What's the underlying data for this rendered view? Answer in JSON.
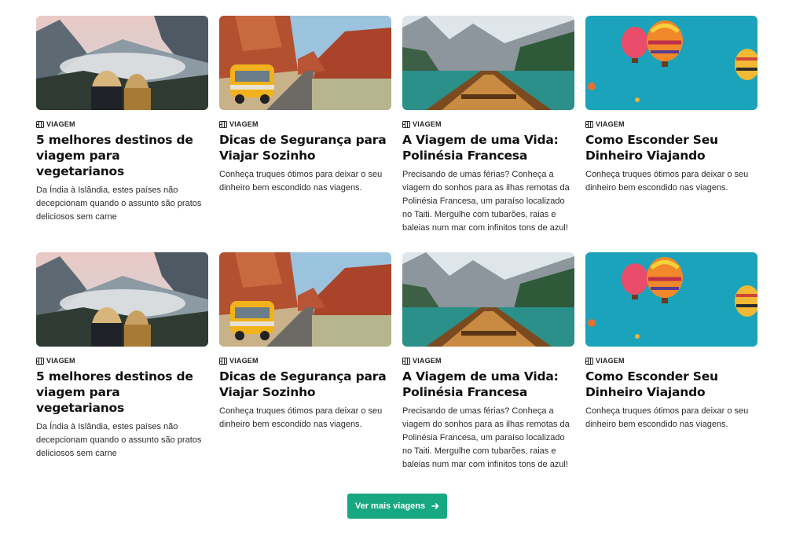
{
  "rows": [
    {
      "cards": [
        {
          "category": "VIAGEM",
          "image": "mountain-valley-two-women",
          "title": "5 melhores destinos de viagem para vegetarianos",
          "description": "Da Índia à Islândia, estes países não decepcionam quando o assunto são pratos deliciosos sem carne"
        },
        {
          "category": "VIAGEM",
          "image": "desert-road-yellow-van",
          "title": "Dicas de Segurança para Viajar Sozinho",
          "description": "Conheça truques ótimos para deixar o seu dinheiro bem escondido nas viagens."
        },
        {
          "category": "VIAGEM",
          "image": "lake-boat-mountains",
          "title": "A Viagem de uma Vida: Polinésia Francesa",
          "description": "Precisando de umas férias? Conheça a viagem do sonhos para as ilhas remotas da Polinésia Francesa, um paraíso localizado no Taiti. Mergulhe com tubarões, raias e baleias num mar com infinitos tons de azul!"
        },
        {
          "category": "VIAGEM",
          "image": "hot-air-balloons",
          "title": "Como Esconder Seu Dinheiro Viajando",
          "description": "Conheça truques ótimos para deixar o seu dinheiro bem escondido nas viagens."
        }
      ]
    },
    {
      "cards": [
        {
          "category": "VIAGEM",
          "image": "mountain-valley-two-women",
          "title": "5 melhores destinos de viagem para vegetarianos",
          "description": "Da Índia à Islândia, estes países não decepcionam quando o assunto são pratos deliciosos sem carne"
        },
        {
          "category": "VIAGEM",
          "image": "desert-road-yellow-van",
          "title": "Dicas de Segurança para Viajar Sozinho",
          "description": "Conheça truques ótimos para deixar o seu dinheiro bem escondido nas viagens."
        },
        {
          "category": "VIAGEM",
          "image": "lake-boat-mountains",
          "title": "A Viagem de uma Vida: Polinésia Francesa",
          "description": "Precisando de umas férias? Conheça a viagem do sonhos para as ilhas remotas da Polinésia Francesa, um paraíso localizado no Taiti. Mergulhe com tubarões, raias e baleias num mar com infinitos tons de azul!"
        },
        {
          "category": "VIAGEM",
          "image": "hot-air-balloons",
          "title": "Como Esconder Seu Dinheiro Viajando",
          "description": "Conheça truques ótimos para deixar o seu dinheiro bem escondido nas viagens."
        }
      ]
    }
  ],
  "more_button": {
    "label": "Ver mais viagens",
    "icon": "arrow-right-icon",
    "color": "#17a882"
  },
  "category_icon": "map-icon"
}
